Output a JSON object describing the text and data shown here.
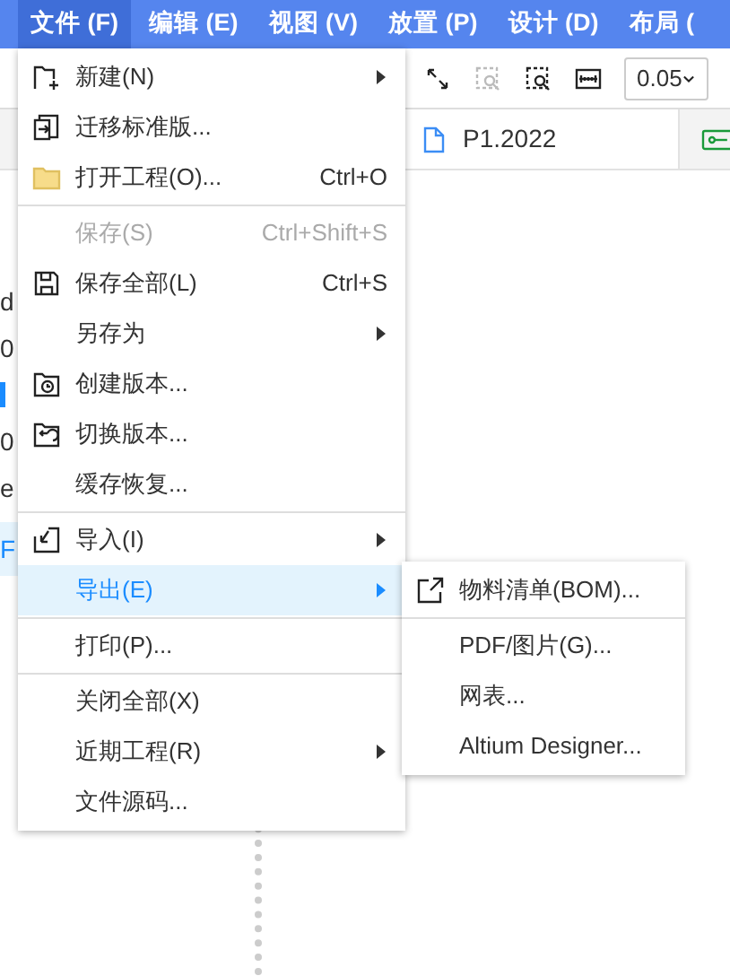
{
  "menubar": [
    {
      "label": "文件 (F)",
      "selected": true
    },
    {
      "label": "编辑 (E)",
      "selected": false
    },
    {
      "label": "视图 (V)",
      "selected": false
    },
    {
      "label": "放置 (P)",
      "selected": false
    },
    {
      "label": "设计 (D)",
      "selected": false
    },
    {
      "label": "布局 (",
      "selected": false
    }
  ],
  "toolbar": {
    "grid_size": "0.05"
  },
  "tabs": [
    {
      "label": "P1.2022",
      "selected": true
    }
  ],
  "left_panel": [
    {
      "text": "d",
      "selected": false
    },
    {
      "text": "0",
      "selected": false
    },
    {
      "text": "0",
      "selected": false
    },
    {
      "text": "e",
      "selected": false
    },
    {
      "text": "F",
      "selected": true
    }
  ],
  "file_menu": [
    {
      "label": "新建(N)",
      "submenu": true,
      "disabled": false,
      "selected": false,
      "separator_before": false
    },
    {
      "label": "迁移标准版...",
      "submenu": false,
      "disabled": false,
      "selected": false,
      "separator_before": false
    },
    {
      "label": "打开工程(O)...",
      "shortcut": "Ctrl+O",
      "submenu": false,
      "disabled": false,
      "selected": false,
      "separator_before": false
    },
    {
      "label": "保存(S)",
      "shortcut": "Ctrl+Shift+S",
      "submenu": false,
      "disabled": true,
      "selected": false,
      "separator_before": true
    },
    {
      "label": "保存全部(L)",
      "shortcut": "Ctrl+S",
      "submenu": false,
      "disabled": false,
      "selected": false,
      "separator_before": false
    },
    {
      "label": "另存为",
      "submenu": true,
      "disabled": false,
      "selected": false,
      "separator_before": false
    },
    {
      "label": "创建版本...",
      "submenu": false,
      "disabled": false,
      "selected": false,
      "separator_before": false
    },
    {
      "label": "切换版本...",
      "submenu": false,
      "disabled": false,
      "selected": false,
      "separator_before": false
    },
    {
      "label": "缓存恢复...",
      "submenu": false,
      "disabled": false,
      "selected": false,
      "separator_before": false
    },
    {
      "label": "导入(I)",
      "submenu": true,
      "disabled": false,
      "selected": false,
      "separator_before": true
    },
    {
      "label": "导出(E)",
      "submenu": true,
      "disabled": false,
      "selected": true,
      "separator_before": false
    },
    {
      "label": "打印(P)...",
      "submenu": false,
      "disabled": false,
      "selected": false,
      "separator_before": true
    },
    {
      "label": "关闭全部(X)",
      "submenu": false,
      "disabled": false,
      "selected": false,
      "separator_before": true
    },
    {
      "label": "近期工程(R)",
      "submenu": true,
      "disabled": false,
      "selected": false,
      "separator_before": false
    },
    {
      "label": "文件源码...",
      "submenu": false,
      "disabled": false,
      "selected": false,
      "separator_before": false
    }
  ],
  "export_submenu": [
    {
      "label": "物料清单(BOM)...",
      "separator_before": false
    },
    {
      "label": "PDF/图片(G)...",
      "separator_before": true
    },
    {
      "label": "网表...",
      "separator_before": false
    },
    {
      "label": "Altium Designer...",
      "separator_before": false
    }
  ]
}
